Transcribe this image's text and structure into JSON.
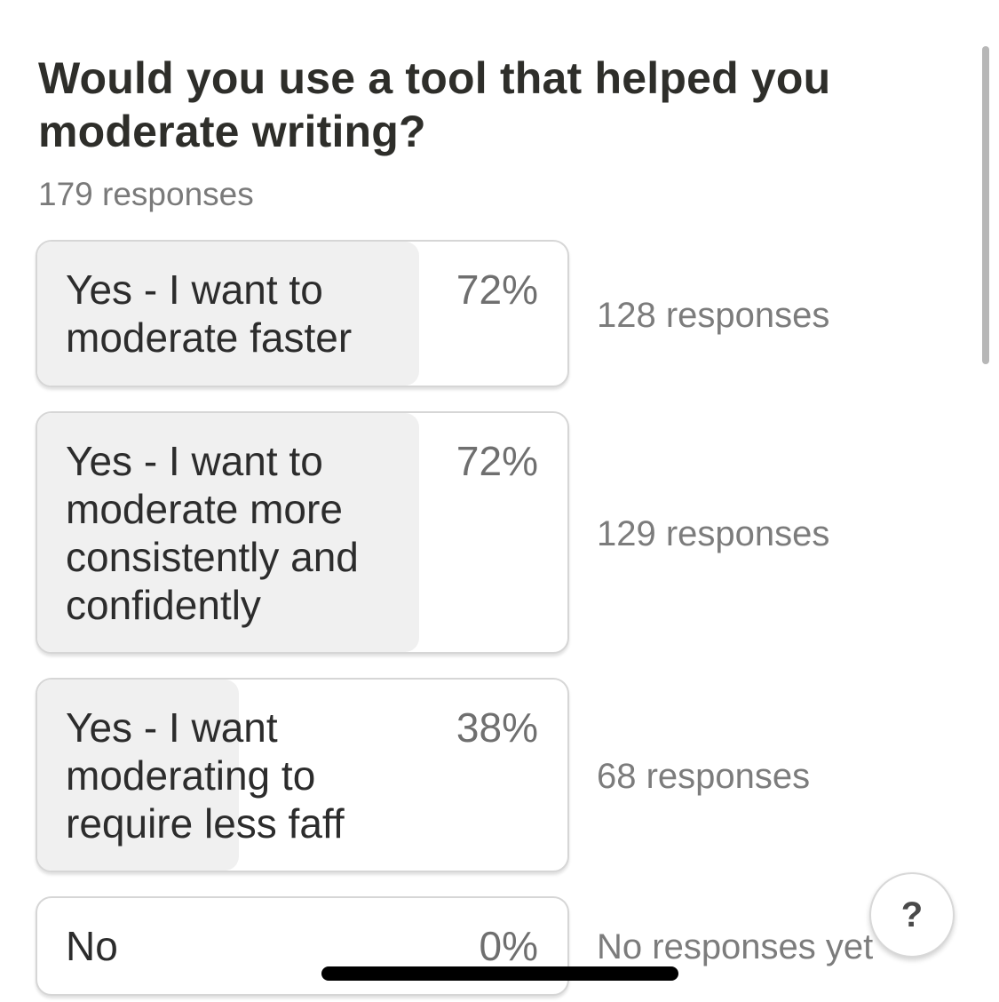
{
  "question": {
    "title": "Would you use a tool that helped you moderate writing?",
    "response_count": "179 responses"
  },
  "options": [
    {
      "label": "Yes - I want to moderate faster",
      "percent_text": "72%",
      "responses_text": "128 responses",
      "fill_fraction": 0.72
    },
    {
      "label": "Yes - I want to moderate more consistently and confidently",
      "percent_text": "72%",
      "responses_text": "129 responses",
      "fill_fraction": 0.72
    },
    {
      "label": "Yes - I want moderating to require less faff",
      "percent_text": "38%",
      "responses_text": "68 responses",
      "fill_fraction": 0.38
    },
    {
      "label": "No",
      "percent_text": "0%",
      "responses_text": "No responses yet",
      "fill_fraction": 0
    }
  ],
  "help_button": {
    "glyph": "?",
    "icon": "question-mark-icon"
  },
  "colors": {
    "fill": "#f0f0f0",
    "card_border": "#d6d6d6",
    "title_text": "#2e2e2a",
    "muted_text": "#7a7a7a"
  }
}
